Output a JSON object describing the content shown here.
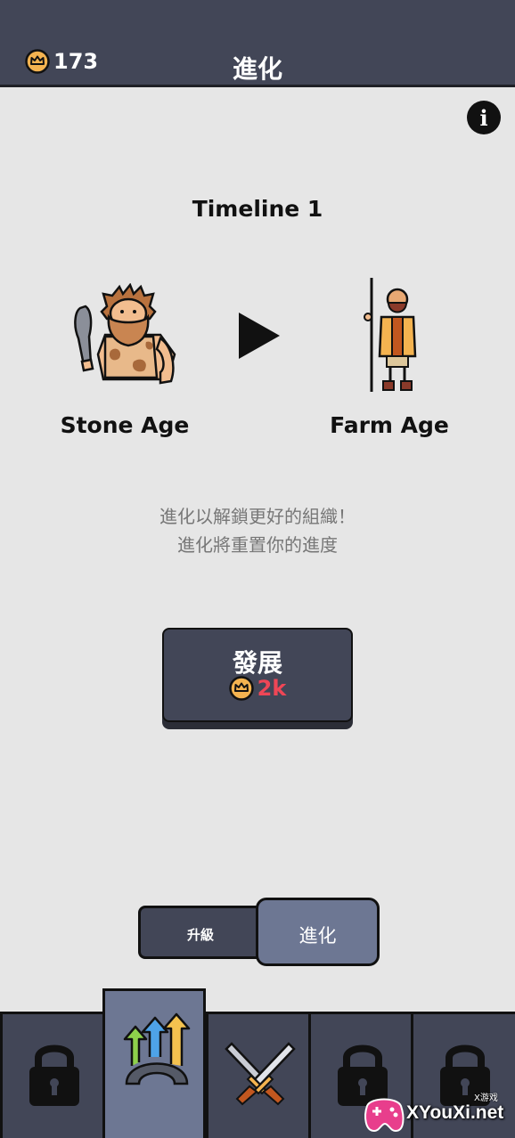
{
  "header": {
    "coins": "173",
    "title": "進化"
  },
  "timeline": {
    "title": "Timeline 1",
    "from_age": "Stone Age",
    "to_age": "Farm Age"
  },
  "description": {
    "line1": "進化以解鎖更好的組織！",
    "line2": "進化將重置你的進度"
  },
  "develop_button": {
    "label": "發展",
    "cost": "2k"
  },
  "segment": {
    "upgrade_label": "升級",
    "evolve_label": "進化",
    "selected": "進化"
  },
  "tabs": [
    {
      "icon": "lock-icon",
      "locked": true
    },
    {
      "icon": "evolve-arrows-icon",
      "active": true
    },
    {
      "icon": "crossed-swords-icon"
    },
    {
      "icon": "lock-icon",
      "locked": true
    },
    {
      "icon": "lock-icon",
      "locked": true
    }
  ],
  "watermark": {
    "text": "XYouXi.net",
    "sub": "X游戏"
  },
  "colors": {
    "header_bg": "#424657",
    "active_tab": "#6d7793",
    "cost_red": "#ef4656",
    "crown_gold": "#f4b350"
  }
}
